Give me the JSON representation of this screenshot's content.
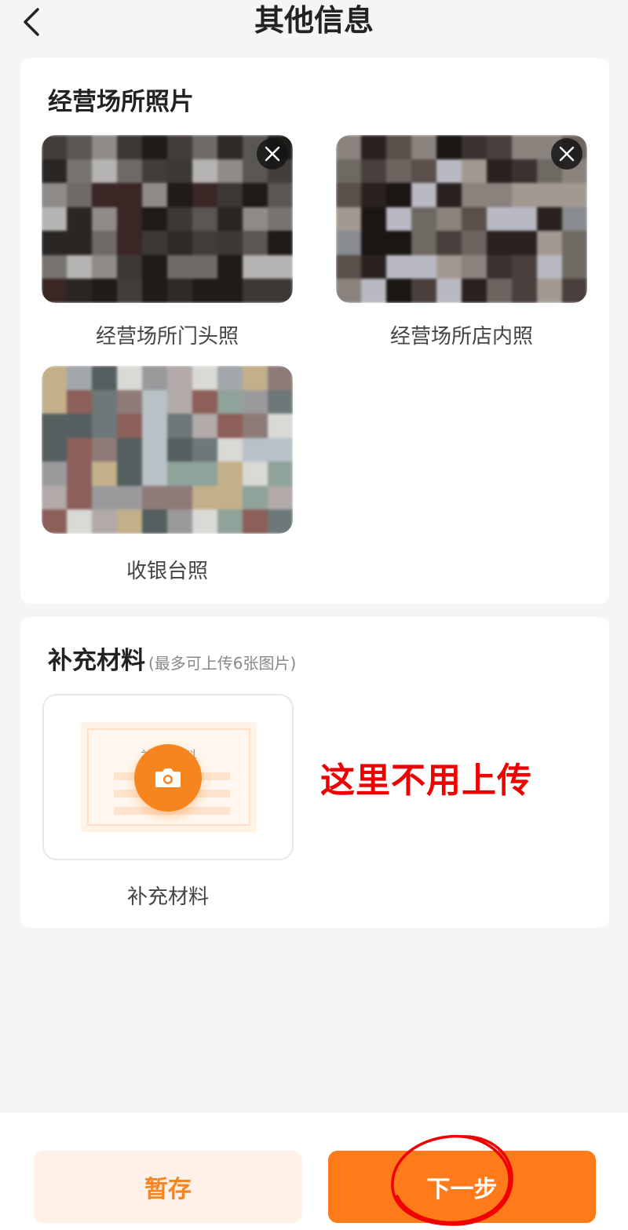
{
  "header": {
    "title": "其他信息",
    "back_icon": "chevron-left-icon"
  },
  "business_photos": {
    "section_title": "经营场所照片",
    "items": [
      {
        "label": "经营场所门头照",
        "has_delete": true
      },
      {
        "label": "经营场所店内照",
        "has_delete": true
      },
      {
        "label": "收银台照",
        "has_delete": false
      }
    ]
  },
  "supplementary": {
    "section_title": "补充材料",
    "hint": "(最多可上传6张图片)",
    "upload_placeholder_caption": "补充材料",
    "upload_label": "补充材料",
    "annotation": "这里不用上传"
  },
  "footer": {
    "save_label": "暂存",
    "next_label": "下一步"
  },
  "colors": {
    "accent": "#ff7a1a",
    "accent_light": "#fff1e8",
    "annotation_red": "#f00000",
    "background": "#f5f5f5"
  }
}
